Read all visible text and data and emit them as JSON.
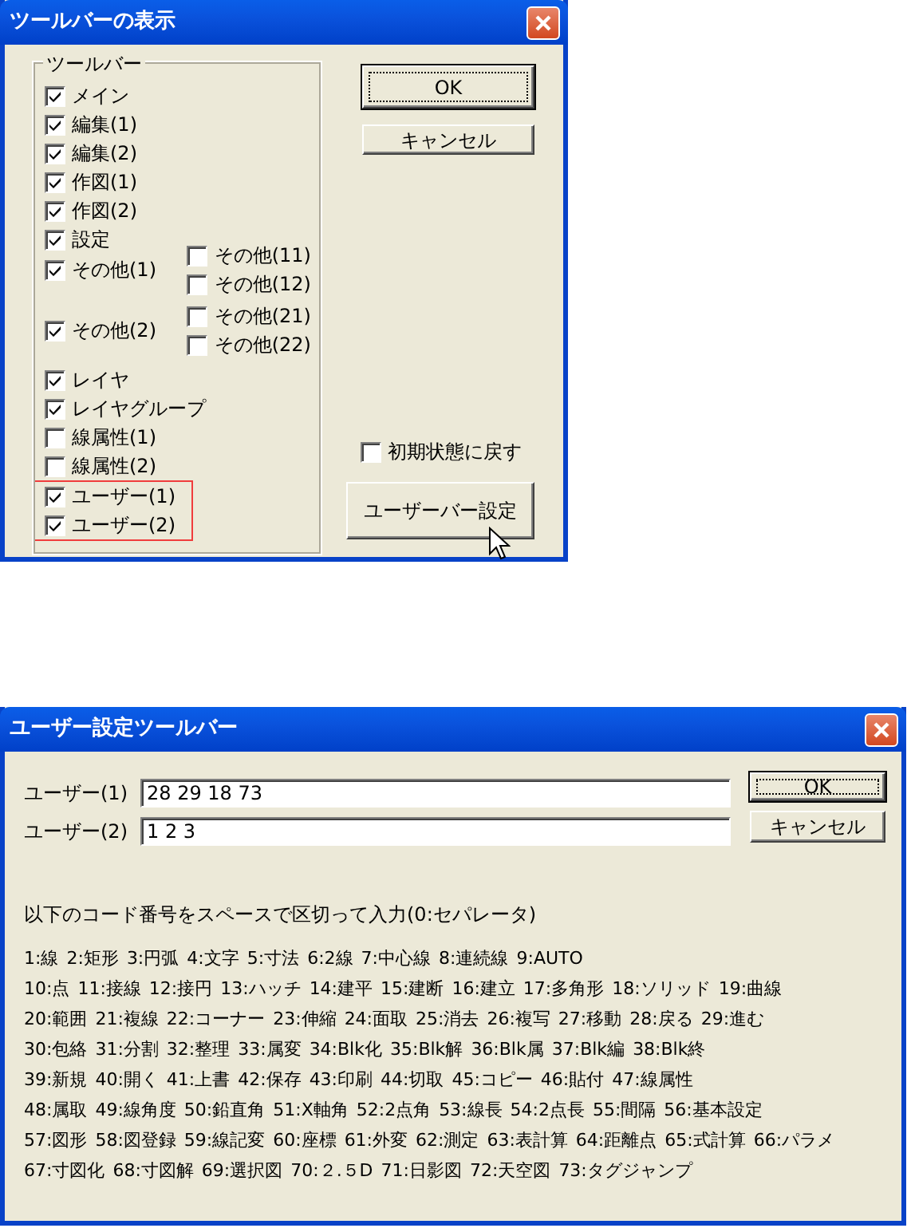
{
  "toolbar_dialog": {
    "title": "ツールバーの表示",
    "group_label": "ツールバー",
    "items": [
      {
        "label": "メイン",
        "checked": true,
        "highlighted": false
      },
      {
        "label": "編集(1)",
        "checked": true,
        "highlighted": false
      },
      {
        "label": "編集(2)",
        "checked": true,
        "highlighted": false
      },
      {
        "label": "作図(1)",
        "checked": true,
        "highlighted": false
      },
      {
        "label": "作図(2)",
        "checked": true,
        "highlighted": false
      },
      {
        "label": "設定",
        "checked": true,
        "highlighted": false
      },
      {
        "label": "その他(1)",
        "checked": true,
        "highlighted": false,
        "sub": [
          {
            "label": "その他(11)",
            "checked": false
          },
          {
            "label": "その他(12)",
            "checked": false
          }
        ]
      },
      {
        "label": "その他(2)",
        "checked": true,
        "highlighted": false,
        "sub": [
          {
            "label": "その他(21)",
            "checked": false
          },
          {
            "label": "その他(22)",
            "checked": false
          }
        ]
      },
      {
        "label": "レイヤ",
        "checked": true,
        "highlighted": false
      },
      {
        "label": "レイヤグループ",
        "checked": true,
        "highlighted": false
      },
      {
        "label": "線属性(1)",
        "checked": false,
        "highlighted": false
      },
      {
        "label": "線属性(2)",
        "checked": false,
        "highlighted": false
      },
      {
        "label": "ユーザー(1)",
        "checked": true,
        "highlighted": true
      },
      {
        "label": "ユーザー(2)",
        "checked": true,
        "highlighted": true
      }
    ],
    "ok_button": "OK",
    "cancel_button": "キャンセル",
    "reset": {
      "label": "初期状態に戻す",
      "checked": false
    },
    "user_bar_button": "ユーザーバー設定"
  },
  "user_dialog": {
    "title": "ユーザー設定ツールバー",
    "fields": [
      {
        "label": "ユーザー(1)",
        "value": "28 29 18 73"
      },
      {
        "label": "ユーザー(2)",
        "value": "1 2 3"
      }
    ],
    "ok_button": "OK",
    "cancel_button": "キャンセル",
    "instruction": "以下のコード番号をスペースで区切って入力(0:セパレータ)",
    "code_lines": [
      [
        "1:線",
        "2:矩形",
        "3:円弧",
        "4:文字",
        "5:寸法",
        "6:2線",
        "7:中心線",
        "8:連続線",
        "9:AUTO"
      ],
      [
        "10:点",
        "11:接線",
        "12:接円",
        "13:ハッチ",
        "14:建平",
        "15:建断",
        "16:建立",
        "17:多角形",
        "18:ソリッド",
        "19:曲線"
      ],
      [
        "20:範囲",
        "21:複線",
        "22:コーナー",
        "23:伸縮",
        "24:面取",
        "25:消去",
        "26:複写",
        "27:移動",
        "28:戻る",
        "29:進む"
      ],
      [
        "30:包絡",
        "31:分割",
        "32:整理",
        "33:属変",
        "34:Blk化",
        "35:Blk解",
        "36:Blk属",
        "37:Blk編",
        "38:Blk終"
      ],
      [
        "39:新規",
        "40:開く",
        "41:上書",
        "42:保存",
        "43:印刷",
        "44:切取",
        "45:コピー",
        "46:貼付",
        "47:線属性"
      ],
      [
        "48:属取",
        "49:線角度",
        "50:鉛直角",
        "51:X軸角",
        "52:2点角",
        "53:線長",
        "54:2点長",
        "55:間隔",
        "56:基本設定"
      ],
      [
        "57:図形",
        "58:図登録",
        "59:線記変",
        "60:座標",
        "61:外変",
        "62:測定",
        "63:表計算",
        "64:距離点",
        "65:式計算",
        "66:パラメ"
      ],
      [
        "67:寸図化",
        "68:寸図解",
        "69:選択図",
        "70:２.５D",
        "71:日影図",
        "72:天空図",
        "73:タグジャンプ"
      ]
    ]
  }
}
